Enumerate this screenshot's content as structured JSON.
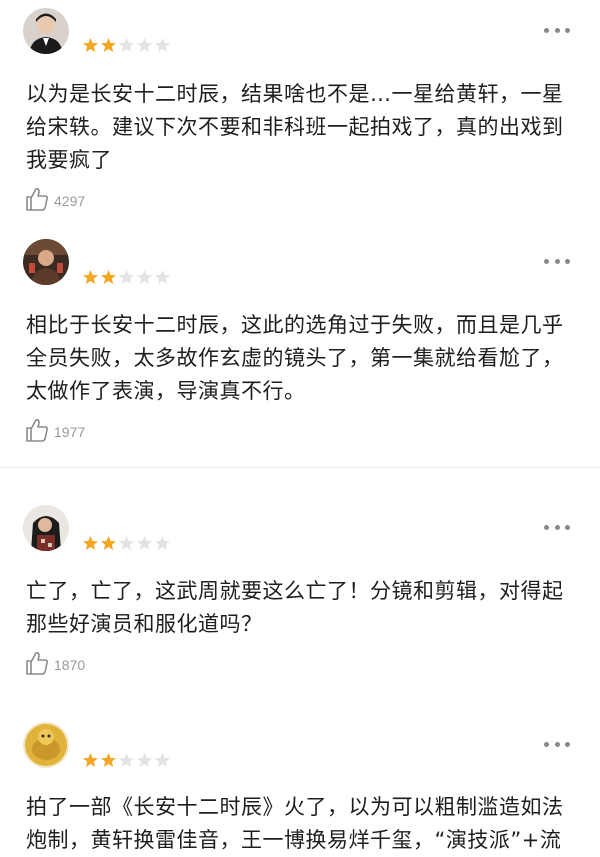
{
  "reviews": [
    {
      "text": "以为是长安十二时辰，结果啥也不是…一星给黄轩，一星给宋轶。建议下次不要和非科班一起拍戏了，真的出戏到我要疯了",
      "likes": "4297",
      "rating": 2,
      "rating_max": 5
    },
    {
      "text": "相比于长安十二时辰，这此的选角过于失败，而且是几乎全员失败，太多故作玄虚的镜头了，第一集就给看尬了，太做作了表演，导演真不行。",
      "likes": "1977",
      "rating": 2,
      "rating_max": 5
    },
    {
      "text": "亡了，亡了，这武周就要这么亡了！分镜和剪辑，对得起那些好演员和服化道吗？",
      "likes": "1870",
      "rating": 2,
      "rating_max": 5
    },
    {
      "text": "拍了一部《长安十二时辰》火了，以为可以粗制滥造如法炮制，黄轩换雷佳音，王一博换易烊千玺，“演技派”+流",
      "likes": "",
      "rating": 2,
      "rating_max": 5
    }
  ],
  "colors": {
    "star_filled": "#f5a623",
    "star_empty": "#e3e3e3",
    "meta_text": "#9a9a9a",
    "body_text": "#1e1e1e"
  },
  "icons": {
    "more": "more-dots-icon",
    "like": "thumbs-up-icon",
    "star": "star-icon"
  }
}
